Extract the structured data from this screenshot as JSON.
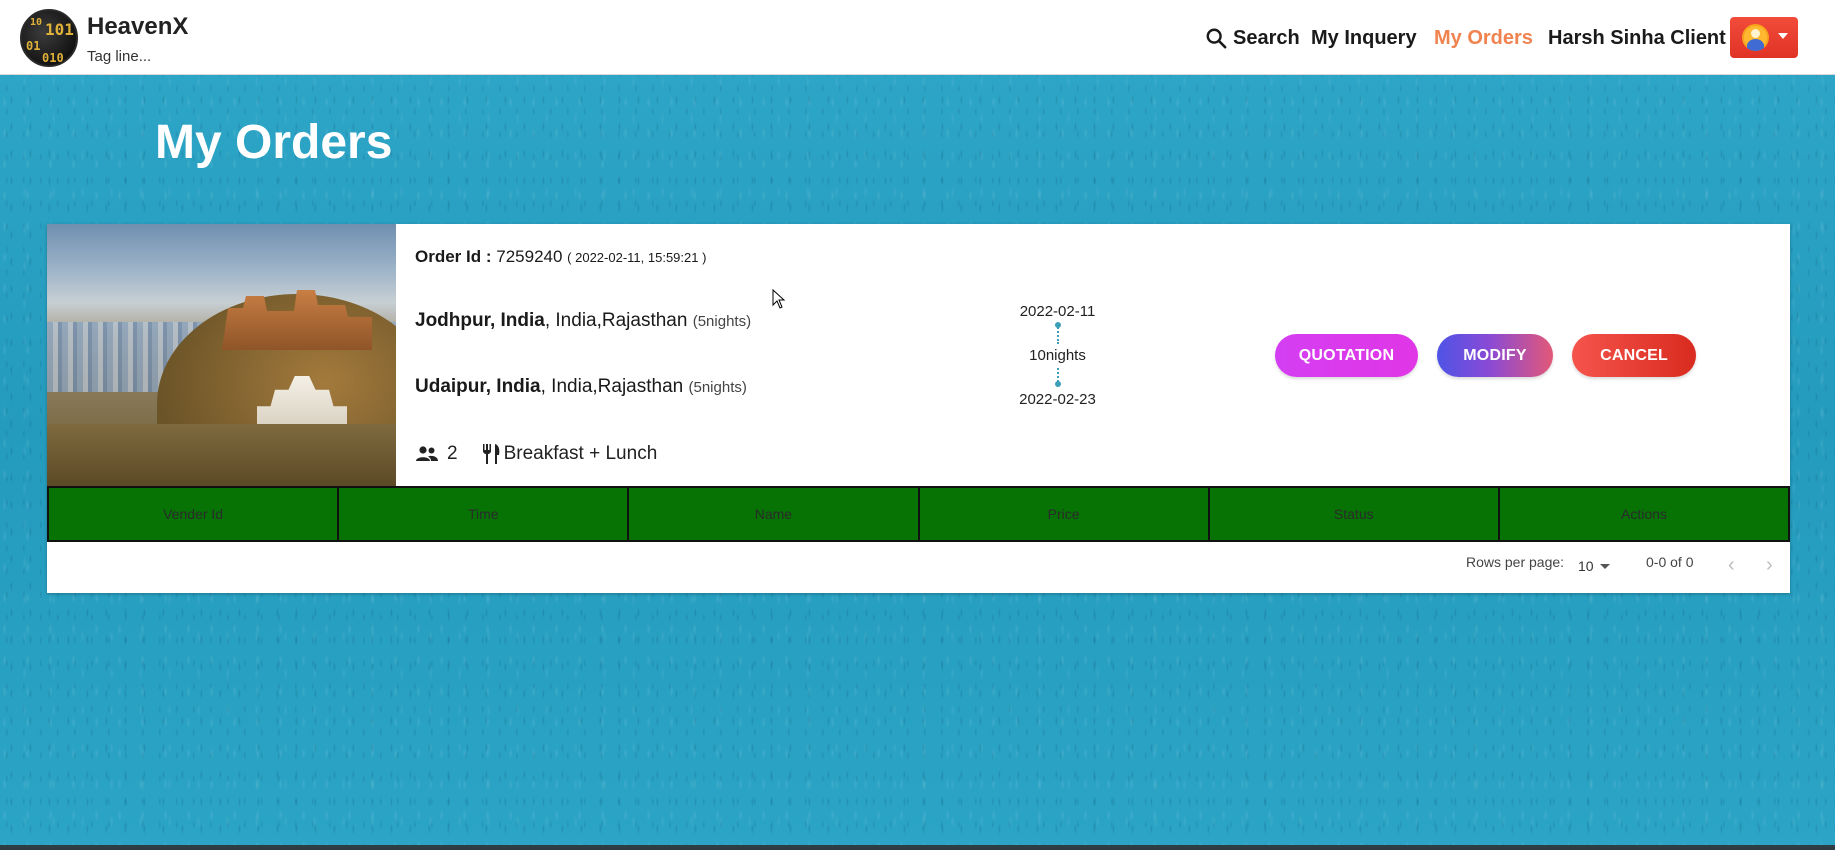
{
  "header": {
    "brand_name": "HeavenX",
    "brand_tagline": "Tag line...",
    "logo_digits": [
      "101",
      "01",
      "010",
      "10"
    ],
    "nav": {
      "search": "Search",
      "inquery": "My Inquery",
      "orders": "My Orders",
      "user": "Harsh Sinha Client"
    },
    "active_color": "#f0834f",
    "avatar_button_color": "#e03326"
  },
  "page": {
    "title": "My Orders"
  },
  "order": {
    "id_label": "Order Id :",
    "id": "7259240",
    "timestamp": "( 2022-02-11, 15:59:21 )",
    "destinations": [
      {
        "city": "Jodhpur, India",
        "region": ", India,Rajasthan",
        "nights": "(5nights)"
      },
      {
        "city": "Udaipur, India",
        "region": ", India,Rajasthan",
        "nights": "(5nights)"
      }
    ],
    "people": "2",
    "meals": "Breakfast + Lunch",
    "timeline": {
      "start": "2022-02-11",
      "duration": "10nights",
      "end": "2022-02-23"
    },
    "actions": {
      "quotation": "QUOTATION",
      "modify": "MODIFY",
      "cancel": "CANCEL"
    }
  },
  "table": {
    "columns": [
      "Vender Id",
      "Time",
      "Name",
      "Price",
      "Status",
      "Actions"
    ],
    "header_color": "#067304",
    "rows": [],
    "pagination": {
      "rows_per_page_label": "Rows per page:",
      "rows_per_page": "10",
      "range": "0-0 of 0"
    }
  }
}
